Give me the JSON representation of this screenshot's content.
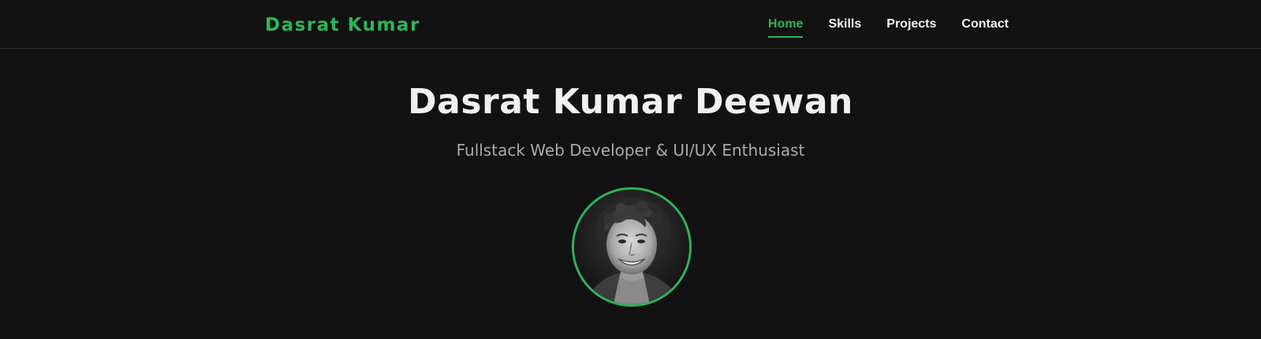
{
  "header": {
    "brand": "Dasrat Kumar",
    "nav": [
      {
        "label": "Home",
        "active": true
      },
      {
        "label": "Skills",
        "active": false
      },
      {
        "label": "Projects",
        "active": false
      },
      {
        "label": "Contact",
        "active": false
      }
    ]
  },
  "hero": {
    "name": "Dasrat Kumar Deewan",
    "tagline": "Fullstack Web Developer & UI/UX Enthusiast",
    "avatar_alt": "profile-photo"
  },
  "colors": {
    "background": "#121212",
    "accent": "#2fb457",
    "text": "#f0f0f0",
    "muted": "#aaaaaa"
  }
}
